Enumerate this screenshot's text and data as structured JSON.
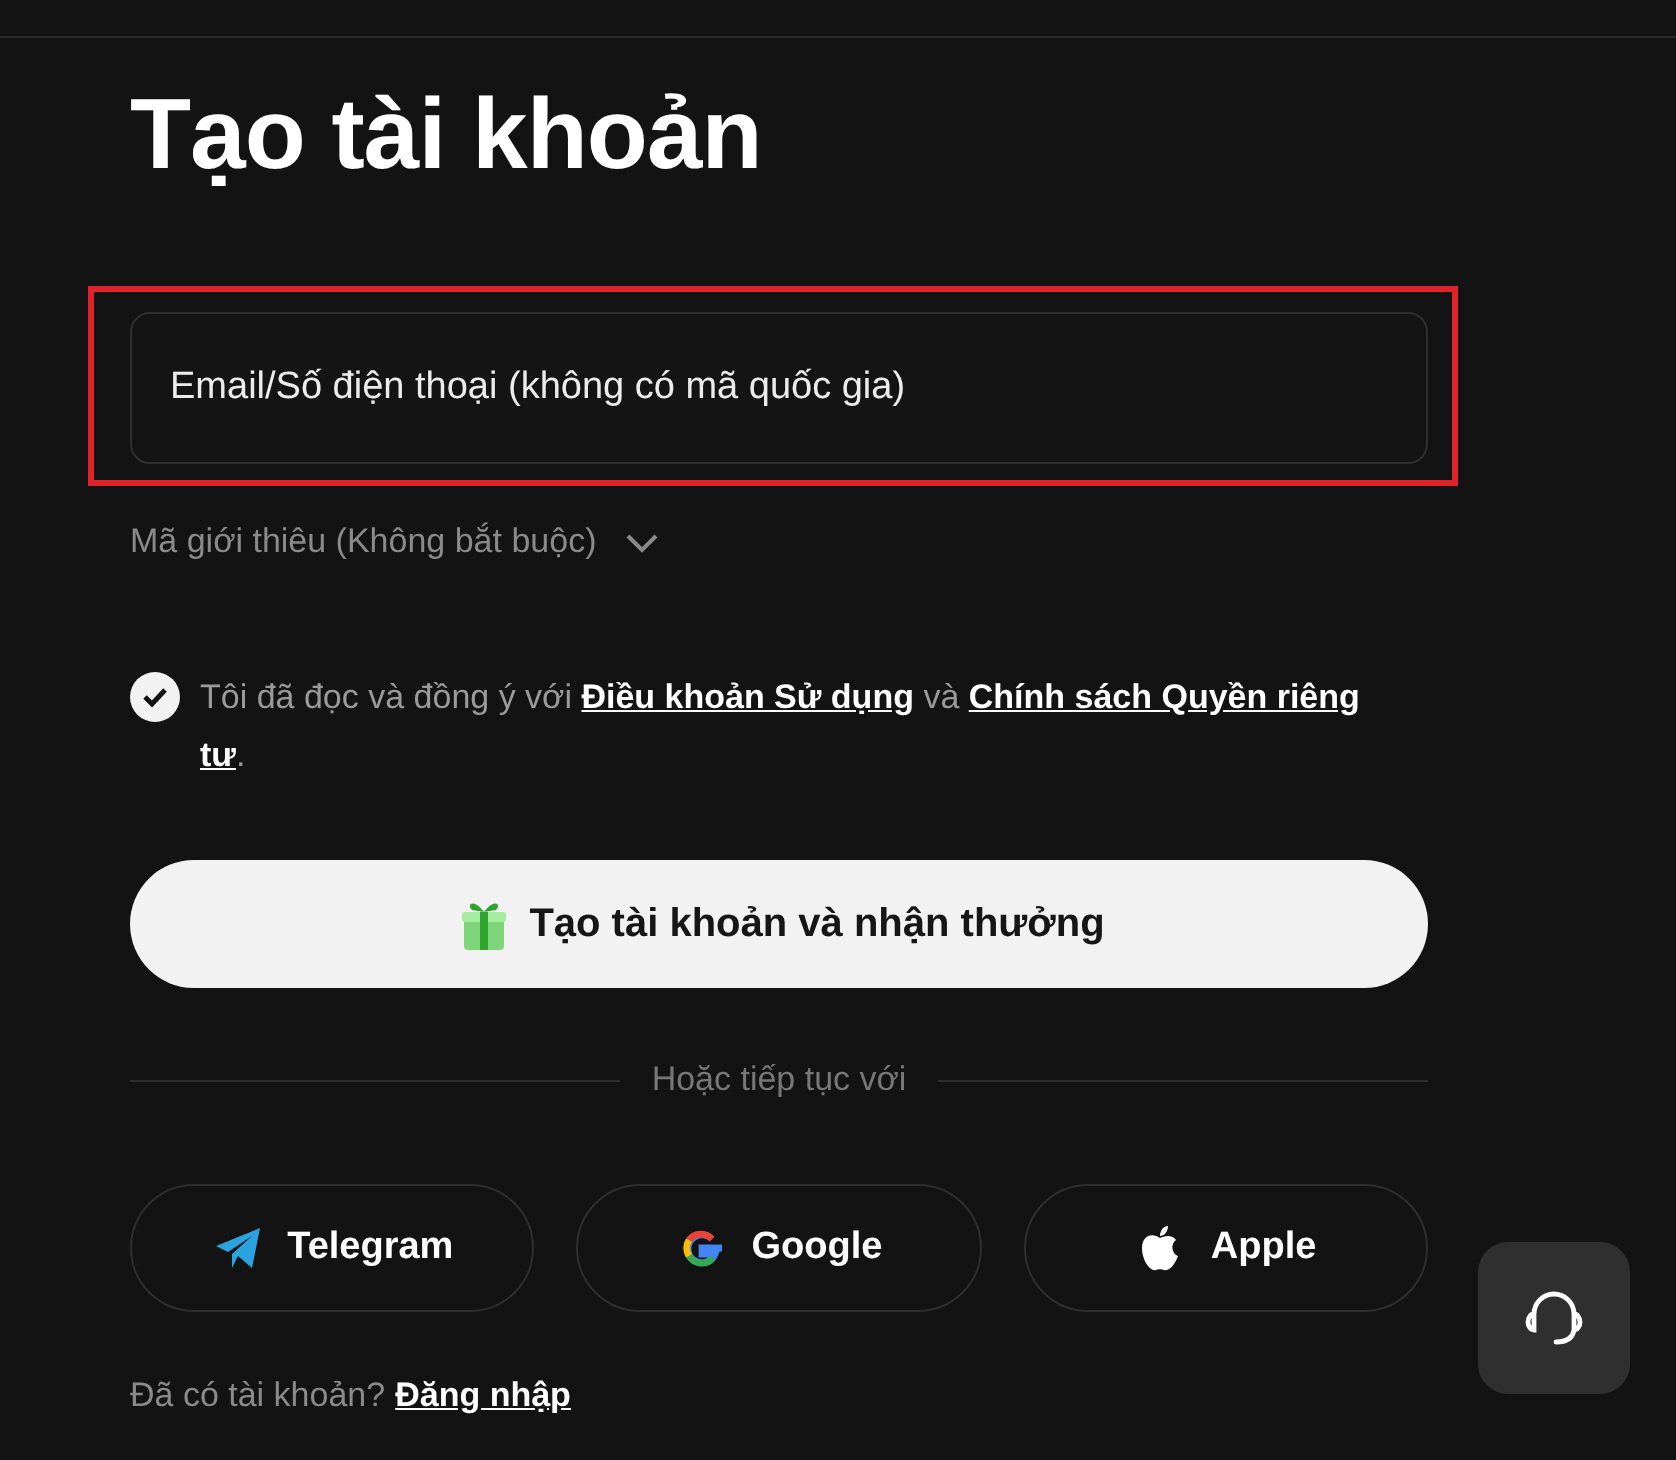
{
  "title": "Tạo tài khoản",
  "account_field": {
    "placeholder": "Email/Số điện thoại (không có mã quốc gia)",
    "highlighted": true
  },
  "referral": {
    "label": "Mã giới thiêu (Không bắt buộc)",
    "expanded": false
  },
  "agreement": {
    "checked": true,
    "text_before": "Tôi đã đọc và đồng ý với",
    "link_1": "Điều khoản Sử dụng",
    "text_between": "và",
    "link_2_lines": [
      "Chính sách Quyền riêng",
      "tư"
    ],
    "text_after": "."
  },
  "create_button": {
    "label": "Tạo tài khoản và nhận thưởng"
  },
  "divider_label": "Hoặc tiếp tục với",
  "social_buttons": [
    {
      "kind": "telegram",
      "label": "Telegram"
    },
    {
      "kind": "google",
      "label": "Google"
    },
    {
      "kind": "apple",
      "label": "Apple"
    }
  ],
  "footer": {
    "text": "Đã có tài khoản?",
    "link": "Đăng nhập"
  }
}
